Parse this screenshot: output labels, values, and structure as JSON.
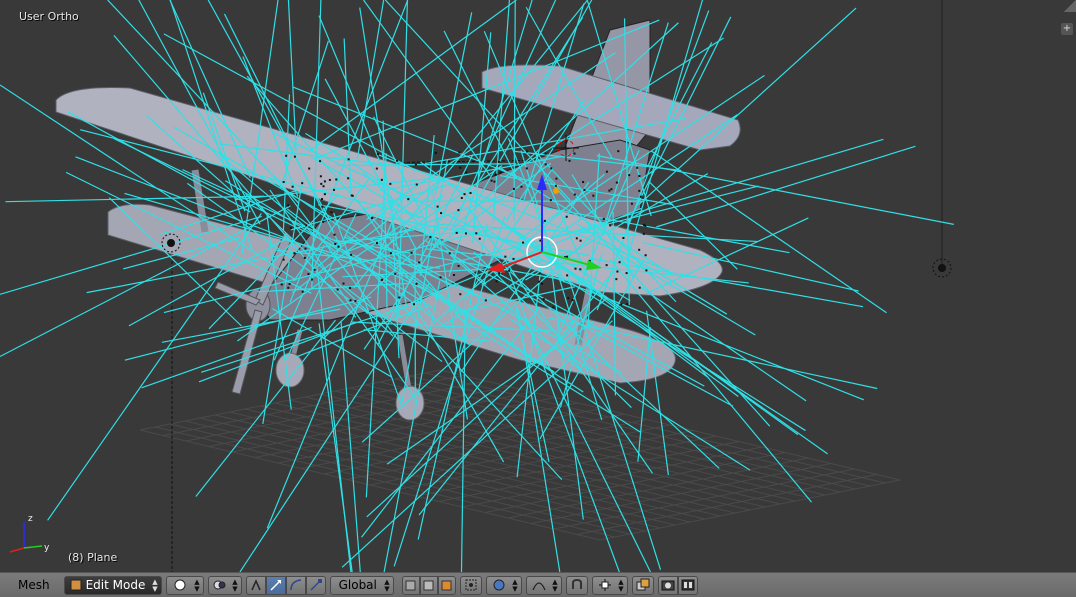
{
  "viewport": {
    "view_label": "User Ortho",
    "object_label": "(8) Plane"
  },
  "header": {
    "menu_mesh": "Mesh",
    "mode_label": "Edit Mode",
    "orientation_label": "Global"
  },
  "colors": {
    "viewport_bg": "#393939",
    "normals": "#2fe0e6",
    "axis_z": "#2020ff",
    "axis_x": "#e02020",
    "axis_y": "#20d020"
  },
  "icons": [
    "mode-icon",
    "viewport-shading-icon",
    "pivot-icon",
    "manipulator-toggle-icon",
    "translate-icon",
    "rotate-icon",
    "scale-icon",
    "vertex-select-icon",
    "edge-select-icon",
    "face-select-icon",
    "occlude-geometry-icon",
    "proportional-edit-icon",
    "falloff-icon",
    "snap-toggle-icon",
    "snap-element-icon",
    "copy-layers-icon",
    "render-icon",
    "render-animation-icon"
  ]
}
